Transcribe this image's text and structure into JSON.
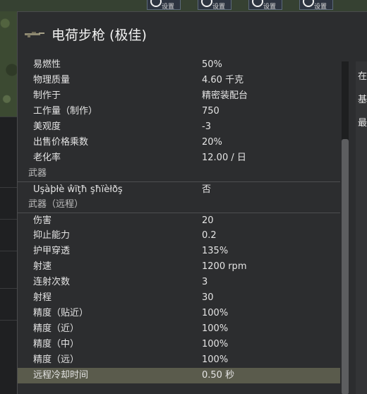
{
  "window": {
    "title": "电荷步枪 (极佳)"
  },
  "toolbar": {
    "buttons": [
      {
        "label": "设置",
        "icon": "clock-icon"
      },
      {
        "label": "设置",
        "icon": "clock-icon"
      },
      {
        "label": "设置",
        "icon": "clock-icon"
      },
      {
        "label": "设置",
        "icon": "clock-icon"
      }
    ]
  },
  "stats_general": [
    {
      "label": "易燃性",
      "value": "50%"
    },
    {
      "label": "物理质量",
      "value": "4.60 千克"
    },
    {
      "label": "制作于",
      "value": "精密装配台"
    },
    {
      "label": "工作量（制作）",
      "value": "750"
    },
    {
      "label": "美观度",
      "value": "-3"
    },
    {
      "label": "出售价格乘数",
      "value": "20%"
    },
    {
      "label": "老化率",
      "value": "12.00 / 日"
    }
  ],
  "category_weapon": "武器",
  "stats_weapon": [
    {
      "label": "Uşàþłè ŵïţħ şħïèłðş",
      "value": "否"
    }
  ],
  "category_ranged": "武器（远程）",
  "stats_ranged": [
    {
      "label": "伤害",
      "value": "20"
    },
    {
      "label": "抑止能力",
      "value": "0.2"
    },
    {
      "label": "护甲穿透",
      "value": "135%"
    },
    {
      "label": "射速",
      "value": "1200 rpm"
    },
    {
      "label": "连射次数",
      "value": "3"
    },
    {
      "label": "射程",
      "value": "30"
    },
    {
      "label": "精度（贴近）",
      "value": "100%"
    },
    {
      "label": "精度（近）",
      "value": "100%"
    },
    {
      "label": "精度（中）",
      "value": "100%"
    },
    {
      "label": "精度（远）",
      "value": "100%"
    },
    {
      "label": "远程冷却时间",
      "value": "0.50 秒"
    }
  ],
  "side_panel": {
    "lines": [
      "在",
      "基",
      "最"
    ]
  },
  "colors": {
    "highlight": "#5a5b4c",
    "panel": "#2c2d2f"
  }
}
